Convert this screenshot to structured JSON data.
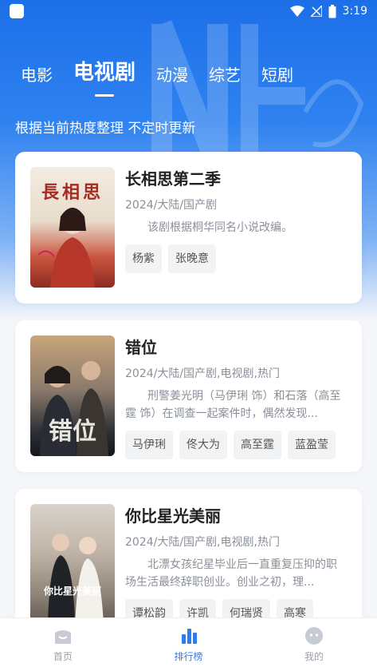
{
  "status": {
    "time": "3:19"
  },
  "tabs": [
    {
      "label": "电影"
    },
    {
      "label": "电视剧"
    },
    {
      "label": "动漫"
    },
    {
      "label": "综艺"
    },
    {
      "label": "短剧"
    }
  ],
  "subtitle": "根据当前热度整理 不定时更新",
  "cards": [
    {
      "poster_text": "長相思",
      "title": "长相思第二季",
      "meta": "2024/大陆/国产剧",
      "desc": "该剧根据桐华同名小说改编。",
      "tags": [
        "杨紫",
        "张晚意"
      ]
    },
    {
      "poster_text": "错位",
      "title": "错位",
      "meta": "2024/大陆/国产剧,电视剧,热门",
      "desc": "刑警姜光明（马伊琍 饰）和石落（高至霆 饰）在调查一起案件时，偶然发现...",
      "tags": [
        "马伊琍",
        "佟大为",
        "高至霆",
        "蓝盈莹"
      ]
    },
    {
      "poster_text": "你比星光美丽",
      "title": "你比星光美丽",
      "meta": "2024/大陆/国产剧,电视剧,热门",
      "desc": "北漂女孩纪星毕业后一直重复压抑的职场生活最终辞职创业。创业之初，理...",
      "tags": [
        "谭松韵",
        "许凯",
        "何瑞贤",
        "高寒"
      ]
    }
  ],
  "nav": [
    {
      "label": "首页"
    },
    {
      "label": "排行榜"
    },
    {
      "label": "我的"
    }
  ],
  "colors": {
    "accent": "#2f7cf0",
    "hero": "#1c6fe8"
  }
}
